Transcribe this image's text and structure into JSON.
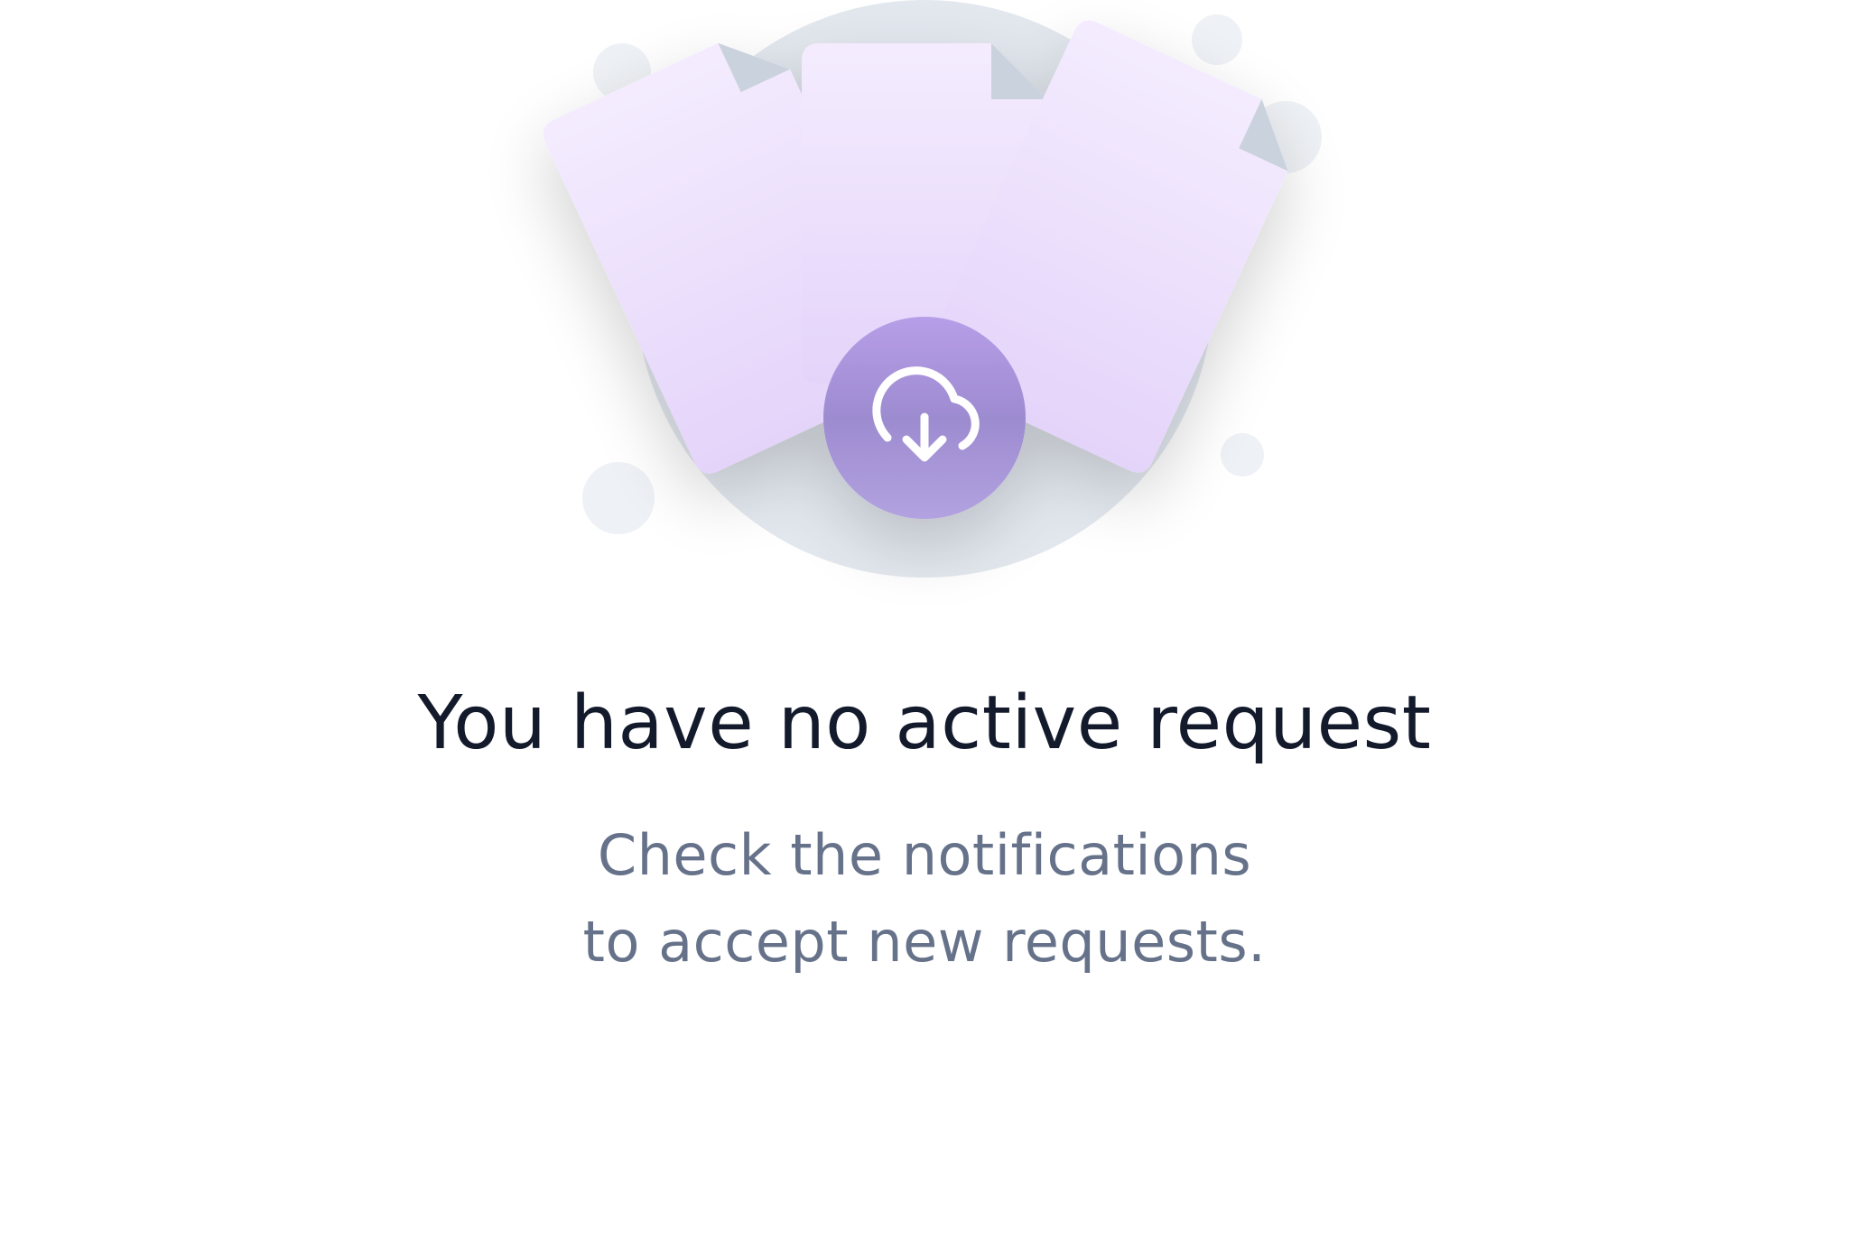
{
  "empty_state": {
    "title": "You have no active request",
    "subtitle_lines": [
      "Check the notifications",
      "to accept new requests."
    ],
    "icon": "cloud-download-icon",
    "colors": {
      "title": "#131a2b",
      "subtitle": "#66728a",
      "card": "#ebdffc",
      "badge": "#a98edd",
      "backdrop": "#e3e8ef"
    }
  }
}
